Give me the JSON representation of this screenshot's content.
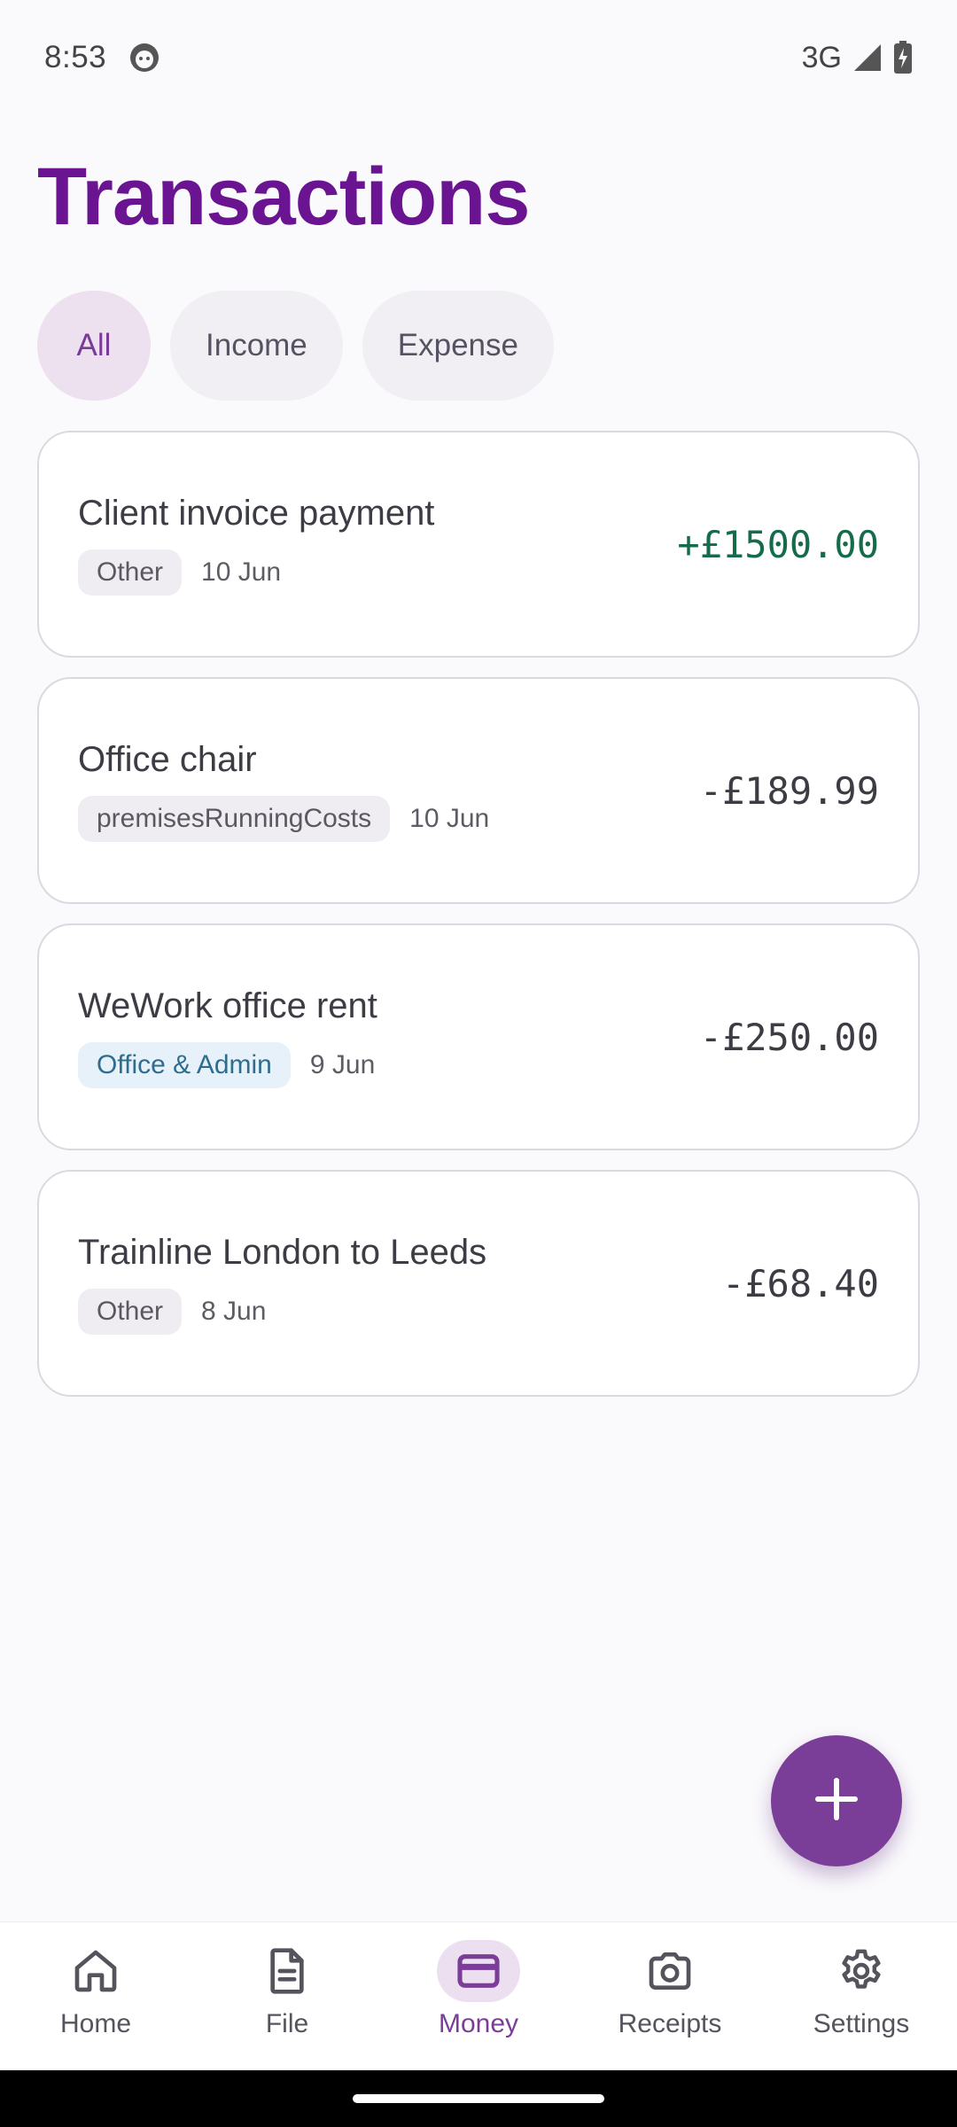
{
  "status_bar": {
    "time": "8:53",
    "network": "3G",
    "icons": [
      "notification-face-icon",
      "signal-icon",
      "battery-charging-icon"
    ]
  },
  "page": {
    "title": "Transactions"
  },
  "filters": {
    "chips": [
      {
        "label": "All",
        "active": true
      },
      {
        "label": "Income",
        "active": false
      },
      {
        "label": "Expense",
        "active": false
      }
    ]
  },
  "transactions": [
    {
      "title": "Client invoice payment",
      "category": "Other",
      "date": "10 Jun",
      "amount": "+£1500.00",
      "type": "income"
    },
    {
      "title": "Office chair",
      "category": "premisesRunningCosts",
      "date": "10 Jun",
      "amount": "-£189.99",
      "type": "expense"
    },
    {
      "title": "WeWork office rent",
      "category": "Office & Admin",
      "date": "9 Jun",
      "amount": "-£250.00",
      "type": "expense"
    },
    {
      "title": "Trainline London to Leeds",
      "category": "Other",
      "date": "8 Jun",
      "amount": "-£68.40",
      "type": "expense"
    }
  ],
  "fab": {
    "icon": "plus-icon"
  },
  "nav": {
    "items": [
      {
        "label": "Home",
        "icon": "home-icon",
        "active": false
      },
      {
        "label": "File",
        "icon": "file-icon",
        "active": false
      },
      {
        "label": "Money",
        "icon": "card-icon",
        "active": true
      },
      {
        "label": "Receipts",
        "icon": "camera-icon",
        "active": false
      },
      {
        "label": "Settings",
        "icon": "gear-icon",
        "active": false
      }
    ]
  },
  "colors": {
    "brand": "#6a1491",
    "accent": "#7a3d98",
    "income": "#146c4a",
    "chip_active_bg": "#ede0ef"
  }
}
